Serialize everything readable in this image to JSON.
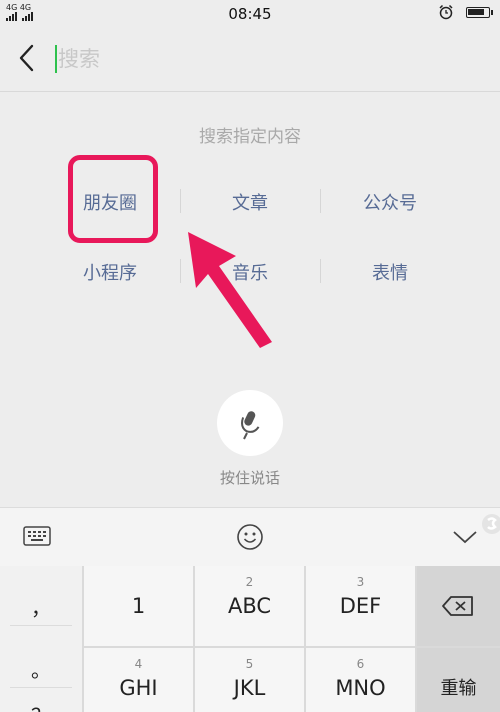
{
  "status_bar": {
    "network": "4G 4G",
    "time": "08:45",
    "battery_level": 0.85
  },
  "search": {
    "placeholder": "搜索"
  },
  "categories": {
    "hint": "搜索指定内容",
    "items": [
      "朋友圈",
      "文章",
      "公众号",
      "小程序",
      "音乐",
      "表情"
    ]
  },
  "voice": {
    "label": "按住说话"
  },
  "keyboard": {
    "symbols": [
      "，",
      "。",
      "？"
    ],
    "keys": [
      {
        "num": "",
        "main": "1"
      },
      {
        "num": "2",
        "main": "ABC"
      },
      {
        "num": "3",
        "main": "DEF"
      },
      {
        "num": "4",
        "main": "GHI"
      },
      {
        "num": "5",
        "main": "JKL"
      },
      {
        "num": "6",
        "main": "MNO"
      }
    ],
    "retype_label": "重输"
  },
  "colors": {
    "accent": "#576b95",
    "highlight": "#e8185a",
    "cursor": "#2ec14d"
  }
}
